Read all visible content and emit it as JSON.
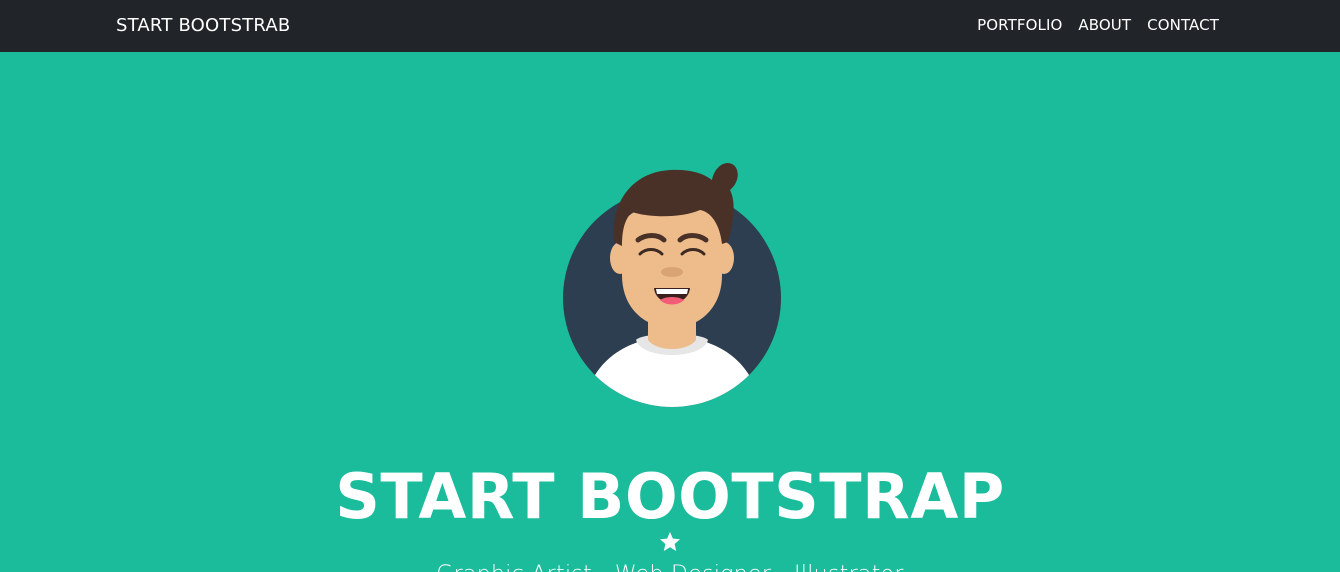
{
  "navbar": {
    "brand": "START BOOTSTRAB",
    "links": [
      "PORTFOLIO",
      "ABOUT",
      "CONTACT"
    ],
    "background": "#212529"
  },
  "hero": {
    "background": "#1abc9c",
    "title": "START BOOTSTRAP",
    "subtitle": "Graphic Artist - Web Designer - Illustrator",
    "avatar_icon": "avatar-illustration",
    "divider_icon": "star-icon"
  },
  "colors": {
    "accent": "#1abc9c",
    "nav": "#212529",
    "avatar_bg": "#2c3e50",
    "text": "#ffffff"
  }
}
